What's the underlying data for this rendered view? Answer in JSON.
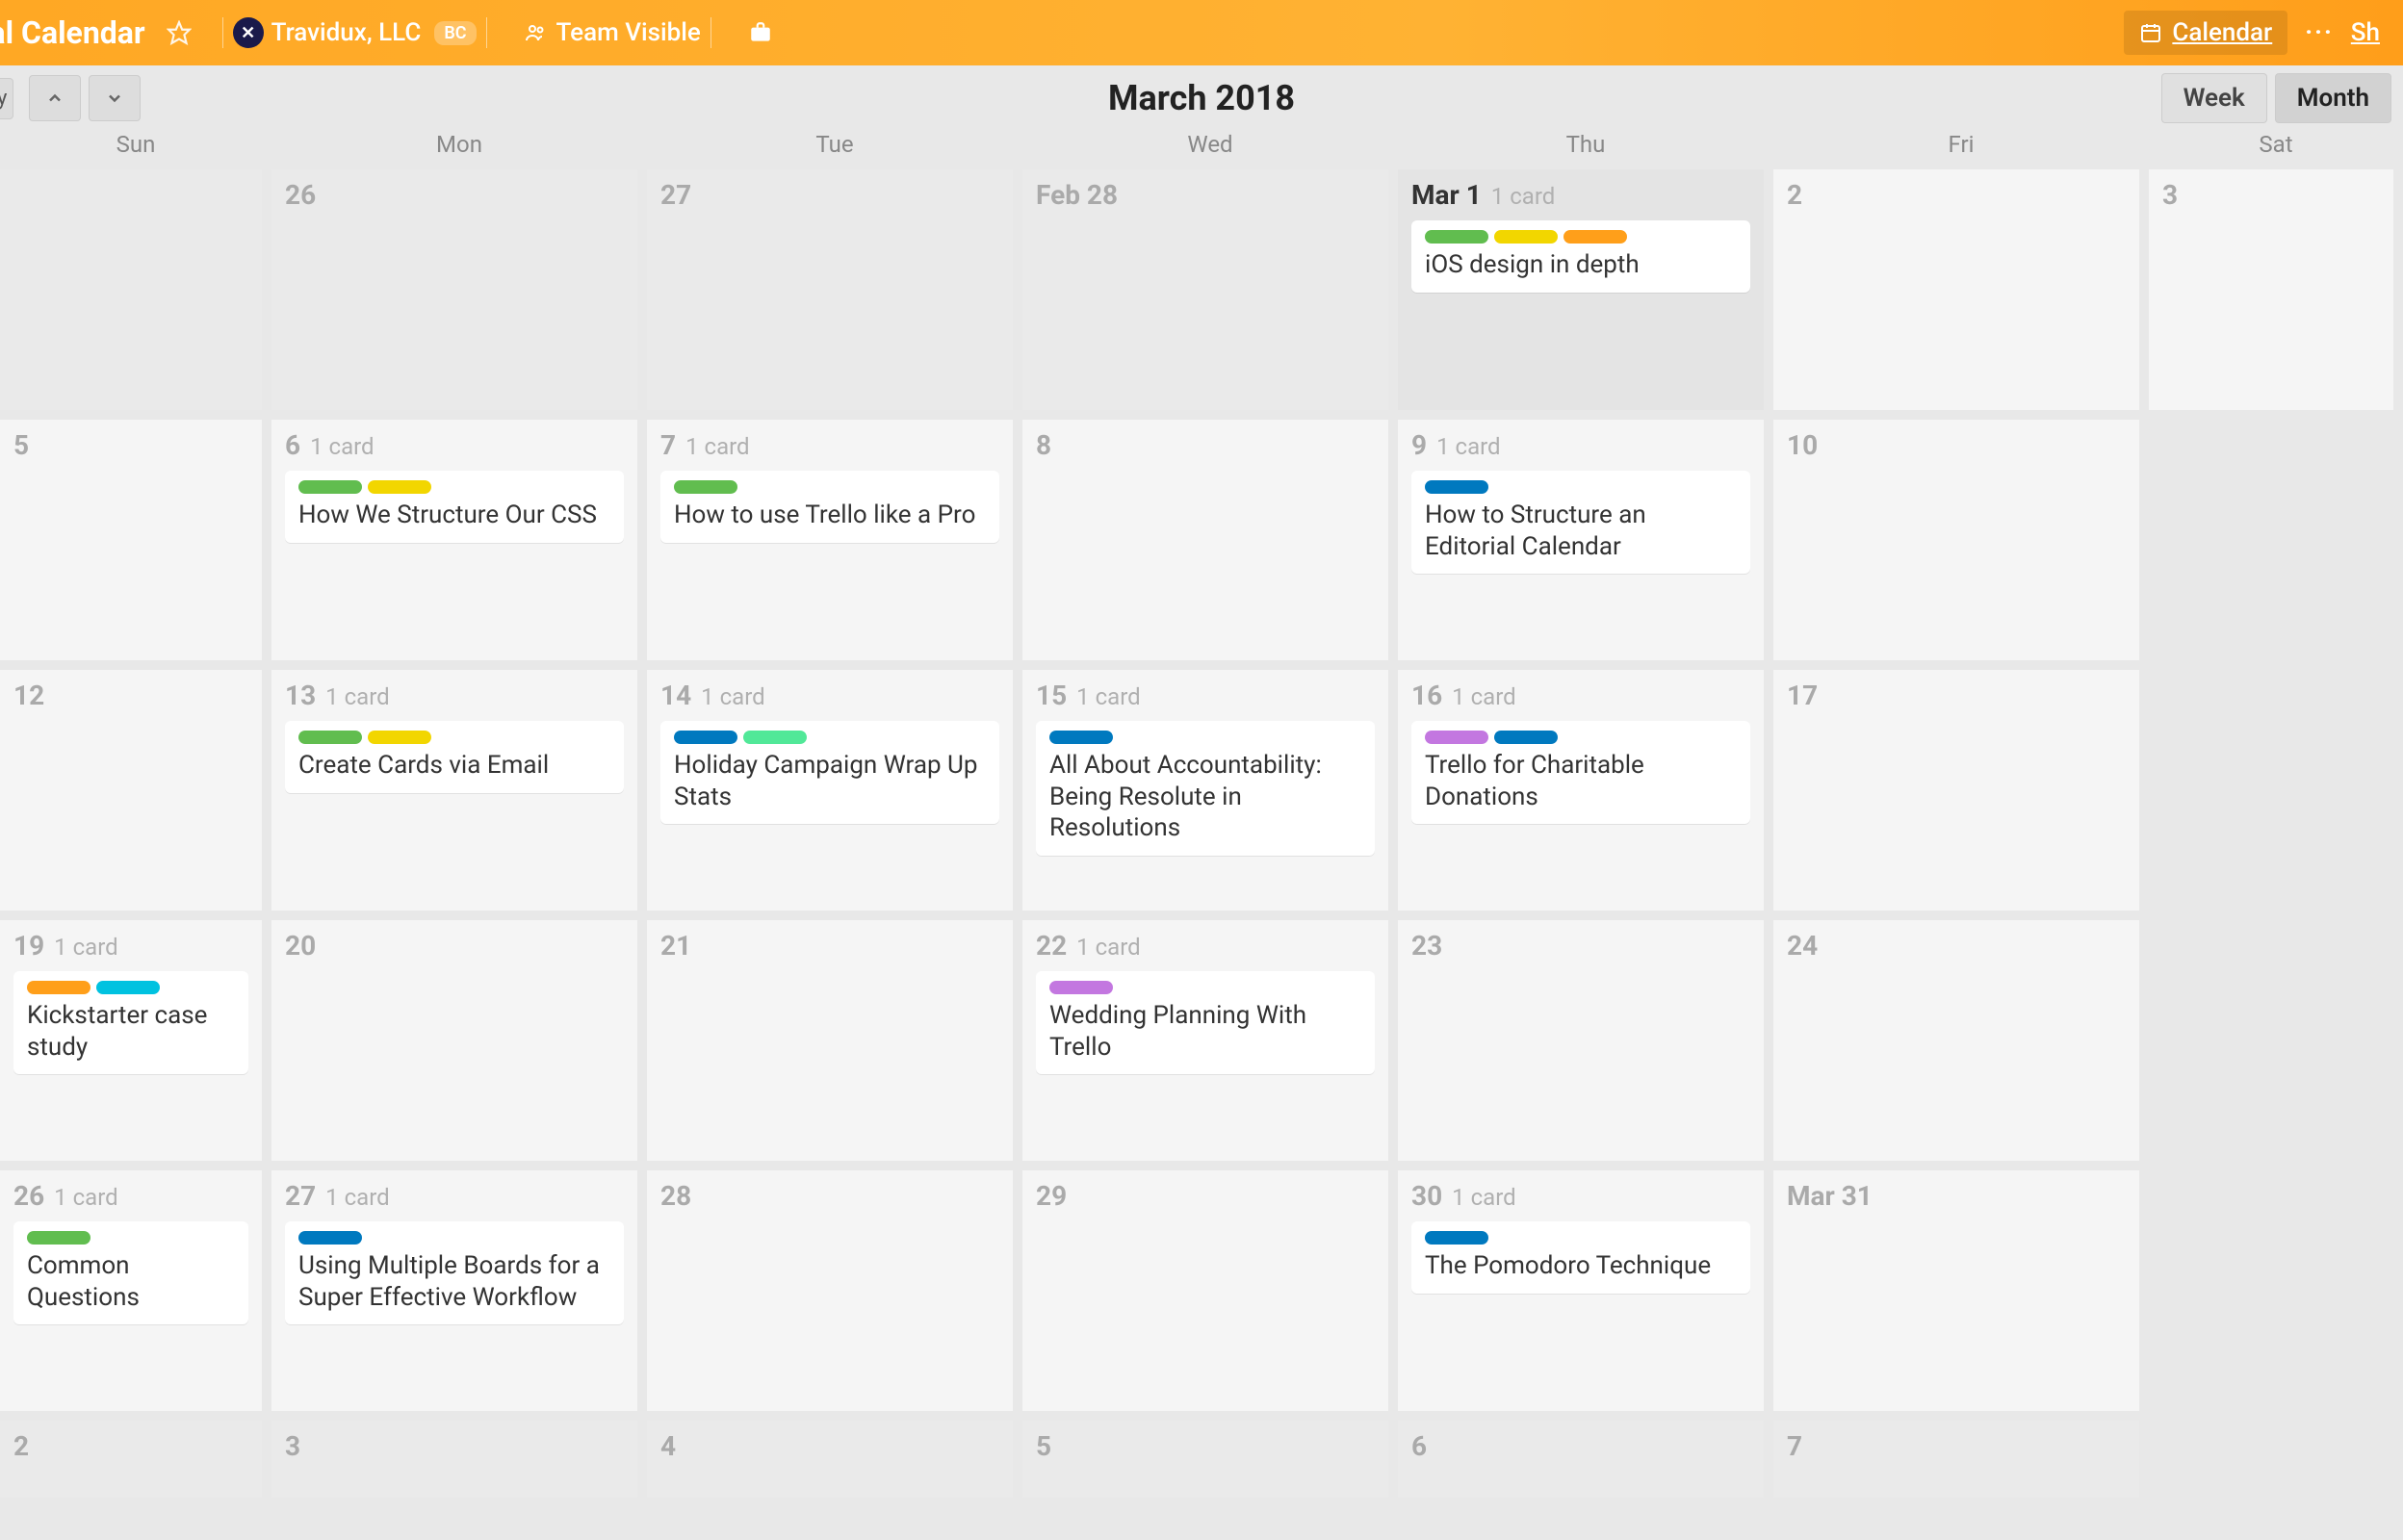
{
  "header": {
    "board_title_fragment": "ial Calendar",
    "org_name": "Travidux, LLC",
    "org_avatar_letter": "✕",
    "bc_badge": "BC",
    "team_visible": "Team Visible",
    "calendar_btn": "Calendar",
    "share": "Sh"
  },
  "toolbar": {
    "today_fragment": "y",
    "month_title": "March 2018",
    "week": "Week",
    "month": "Month"
  },
  "dow": [
    "Sun",
    "Mon",
    "Tue",
    "Wed",
    "Thu",
    "Fri",
    "Sat"
  ],
  "weeks": [
    [
      {
        "label": "",
        "out": true
      },
      {
        "label": "26",
        "out": true
      },
      {
        "label": "27",
        "out": true
      },
      {
        "label": "Feb 28",
        "out": true
      },
      {
        "label": "Mar 1",
        "today": true,
        "count": "1 card",
        "cards": [
          {
            "labels": [
              "green",
              "yellow",
              "orange"
            ],
            "title": "iOS design in depth"
          }
        ]
      },
      {
        "label": "2"
      },
      {
        "label": "3"
      }
    ],
    [
      {
        "label": "5"
      },
      {
        "label": "6",
        "count": "1 card",
        "cards": [
          {
            "labels": [
              "green",
              "yellow"
            ],
            "title": "How We Structure Our CSS"
          }
        ]
      },
      {
        "label": "7",
        "count": "1 card",
        "cards": [
          {
            "labels": [
              "green"
            ],
            "title": "How to use Trello like a Pro"
          }
        ]
      },
      {
        "label": "8"
      },
      {
        "label": "9",
        "count": "1 card",
        "cards": [
          {
            "labels": [
              "blue"
            ],
            "title": "How to Structure an Editorial Calendar"
          }
        ]
      },
      {
        "label": "10"
      },
      {
        "label": "",
        "hidden": true
      }
    ],
    [
      {
        "label": "12"
      },
      {
        "label": "13",
        "count": "1 card",
        "cards": [
          {
            "labels": [
              "green",
              "yellow"
            ],
            "title": "Create Cards via Email"
          }
        ]
      },
      {
        "label": "14",
        "count": "1 card",
        "cards": [
          {
            "labels": [
              "blue",
              "lime"
            ],
            "title": "Holiday Campaign Wrap Up Stats"
          }
        ]
      },
      {
        "label": "15",
        "count": "1 card",
        "cards": [
          {
            "labels": [
              "blue"
            ],
            "title": "All About Accountability: Being Resolute in Resolutions"
          }
        ]
      },
      {
        "label": "16",
        "count": "1 card",
        "cards": [
          {
            "labels": [
              "purple",
              "blue"
            ],
            "title": "Trello for Charitable Donations"
          }
        ]
      },
      {
        "label": "17"
      },
      {
        "label": "",
        "hidden": true
      }
    ],
    [
      {
        "label": "19",
        "count": "1 card",
        "cards": [
          {
            "labels": [
              "orange",
              "cyan"
            ],
            "title": "Kickstarter case study"
          }
        ]
      },
      {
        "label": "20"
      },
      {
        "label": "21"
      },
      {
        "label": "22",
        "count": "1 card",
        "cards": [
          {
            "labels": [
              "purple"
            ],
            "title": "Wedding Planning With Trello"
          }
        ]
      },
      {
        "label": "23"
      },
      {
        "label": "24"
      },
      {
        "label": "",
        "hidden": true
      }
    ],
    [
      {
        "label": "26",
        "count": "1 card",
        "cards": [
          {
            "labels": [
              "green"
            ],
            "title": "Common Questions"
          }
        ]
      },
      {
        "label": "27",
        "count": "1 card",
        "cards": [
          {
            "labels": [
              "blue"
            ],
            "title": "Using Multiple Boards for a Super Effective Workflow"
          }
        ]
      },
      {
        "label": "28"
      },
      {
        "label": "29"
      },
      {
        "label": "30",
        "count": "1 card",
        "cards": [
          {
            "labels": [
              "blue"
            ],
            "title": "The Pomodoro Technique"
          }
        ]
      },
      {
        "label": "Mar 31"
      },
      {
        "label": "",
        "hidden": true
      }
    ],
    [
      {
        "label": "2",
        "out": true
      },
      {
        "label": "3",
        "out": true
      },
      {
        "label": "4",
        "out": true
      },
      {
        "label": "5",
        "out": true
      },
      {
        "label": "6",
        "out": true
      },
      {
        "label": "7",
        "out": true
      },
      {
        "label": "",
        "hidden": true
      }
    ]
  ]
}
